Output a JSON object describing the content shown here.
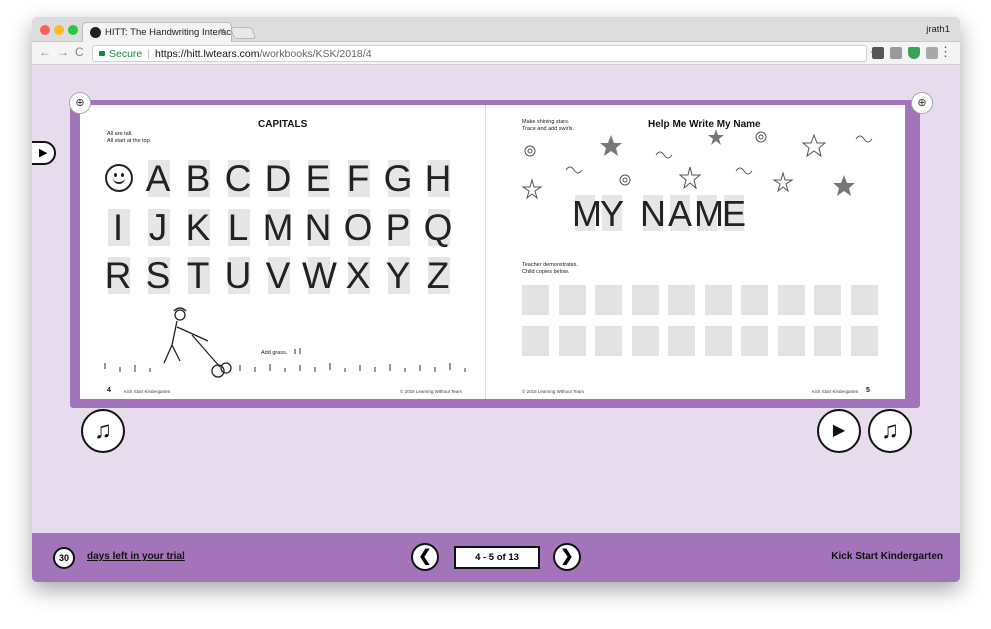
{
  "browser": {
    "tab_title": "HITT: The Handwriting Interac",
    "tab_close": "×",
    "profile": "jrath1",
    "secure_label": "Secure",
    "url_host": "https://hitt.lwtears.com",
    "url_path": "/workbooks/KSK/2018/4",
    "back": "←",
    "forward": "→",
    "reload": "C",
    "bookmark": "☆",
    "menu": "⋮",
    "traffic_colors": [
      "#fc5f57",
      "#fdbc2e",
      "#28c840"
    ]
  },
  "workbook": {
    "left_page": {
      "title": "CAPITALS",
      "instructions": [
        "All are tall.",
        "All start at the top."
      ],
      "row1": [
        "A",
        "B",
        "C",
        "D",
        "E",
        "F",
        "G",
        "H"
      ],
      "row2": [
        "I",
        "J",
        "K",
        "L",
        "M",
        "N",
        "O",
        "P",
        "Q"
      ],
      "row3": [
        "R",
        "S",
        "T",
        "U",
        "V",
        "W",
        "X",
        "Y",
        "Z"
      ],
      "grass_label": "Add grass.",
      "page_number": "4",
      "footer_left": "Kick Start Kindergarten",
      "footer_right": "© 2018 Learning Without Tears"
    },
    "right_page": {
      "title": "Help Me Write My Name",
      "instructions": [
        "Make shining stars.",
        "Trace and add swirls."
      ],
      "name_letters": [
        "M",
        "Y",
        " ",
        "N",
        "A",
        "M",
        "E"
      ],
      "teacher_note": [
        "Teacher demonstrates.",
        "Child copies below."
      ],
      "page_number": "5",
      "footer_left": "© 2018 Learning Without Tears",
      "footer_right": "Kick Start Kindergarten"
    }
  },
  "controls": {
    "zoom_icon": "⊕",
    "music_icon": "♫",
    "play_icon": "▶",
    "prev": "❮",
    "next": "❯",
    "page_indicator": "4 - 5 of 13",
    "trial_days": "30",
    "trial_text": "days left in your trial",
    "book_title": "Kick Start Kindergarten"
  },
  "colors": {
    "accent": "#a374b9",
    "stage": "#e6dcee",
    "secure": "#1a8a3a"
  }
}
